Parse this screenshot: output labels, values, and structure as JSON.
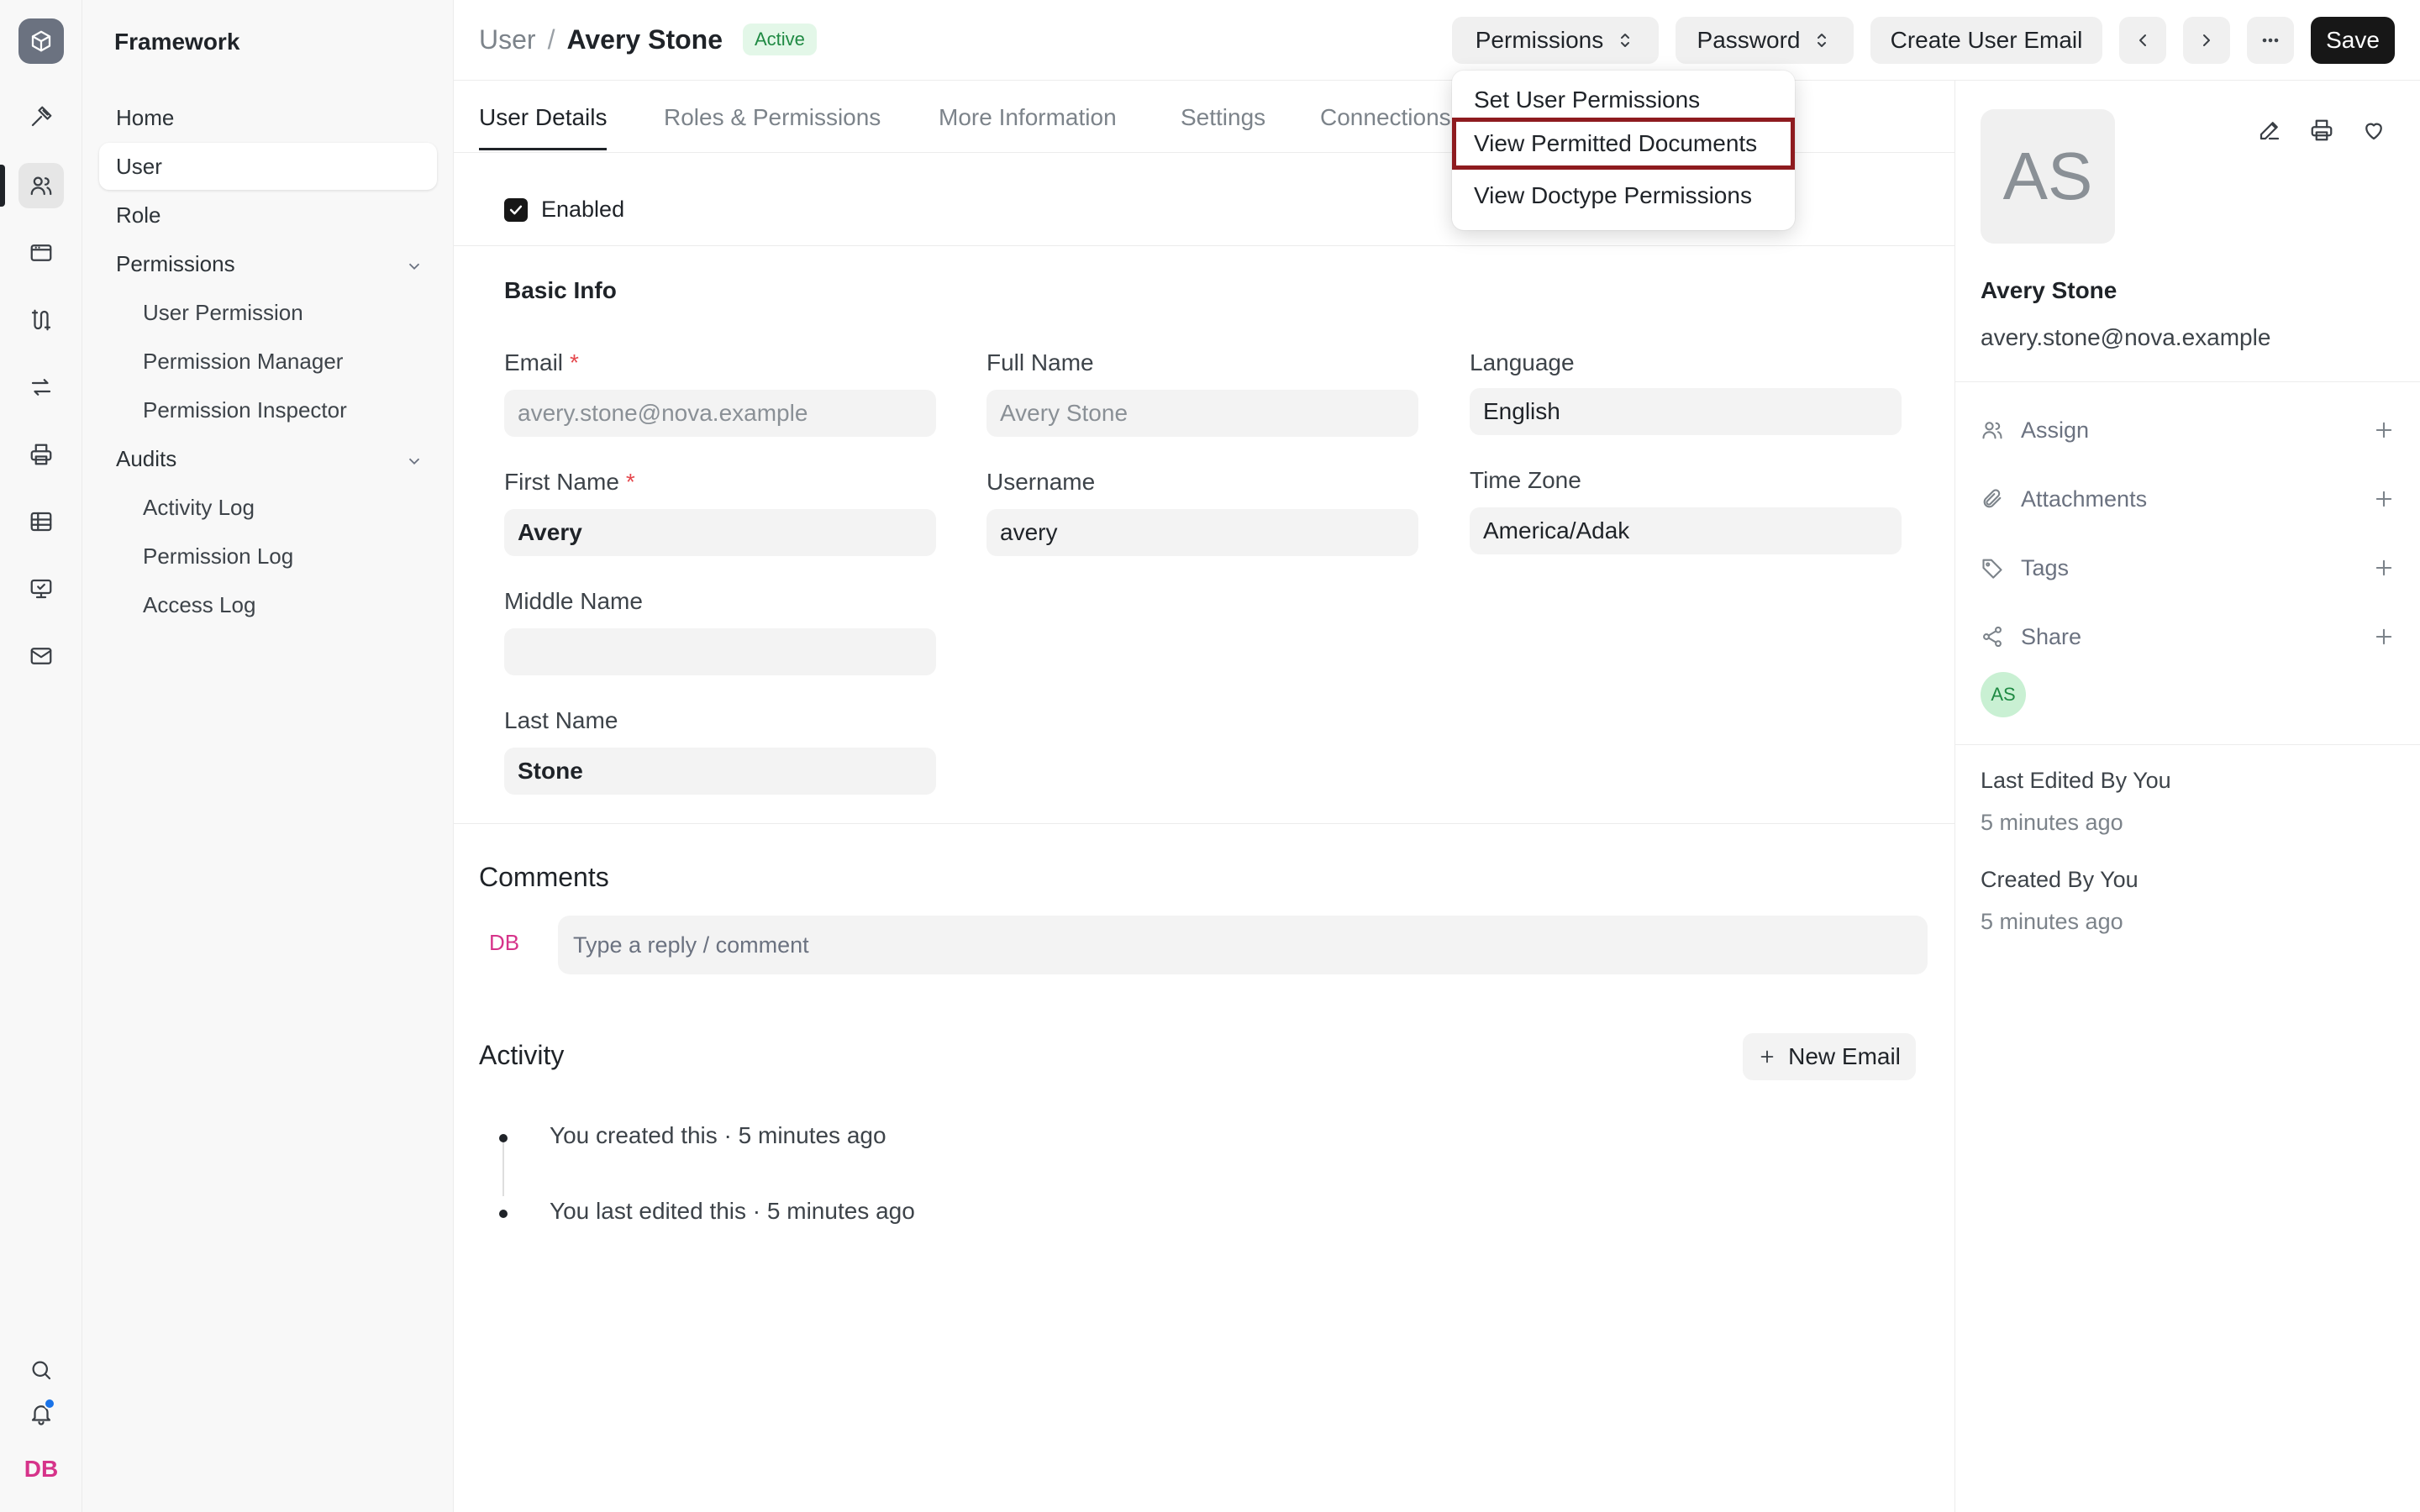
{
  "rail": {
    "user_initials": "DB"
  },
  "sidebar": {
    "app_name": "Framework",
    "items": [
      {
        "label": "Home"
      },
      {
        "label": "User"
      },
      {
        "label": "Role"
      },
      {
        "label": "Permissions"
      },
      {
        "label": "User Permission"
      },
      {
        "label": "Permission Manager"
      },
      {
        "label": "Permission Inspector"
      },
      {
        "label": "Audits"
      },
      {
        "label": "Activity Log"
      },
      {
        "label": "Permission Log"
      },
      {
        "label": "Access Log"
      }
    ]
  },
  "header": {
    "breadcrumb_parent": "User",
    "breadcrumb_sep": "/",
    "title": "Avery Stone",
    "status": "Active",
    "permissions_label": "Permissions",
    "password_label": "Password",
    "create_email_label": "Create User Email",
    "save_label": "Save"
  },
  "dropdown": {
    "items": [
      {
        "label": "Set User Permissions"
      },
      {
        "label": "View Permitted Documents"
      },
      {
        "label": "View Doctype Permissions"
      }
    ]
  },
  "tabs": [
    {
      "label": "User Details"
    },
    {
      "label": "Roles & Permissions"
    },
    {
      "label": "More Information"
    },
    {
      "label": "Settings"
    },
    {
      "label": "Connections"
    }
  ],
  "form": {
    "enabled_label": "Enabled",
    "basic_info_title": "Basic Info",
    "email": {
      "label": "Email",
      "value": "avery.stone@nova.example"
    },
    "full_name": {
      "label": "Full Name",
      "value": "Avery Stone"
    },
    "language": {
      "label": "Language",
      "value": "English"
    },
    "first_name": {
      "label": "First Name",
      "value": "Avery"
    },
    "username": {
      "label": "Username",
      "value": "avery"
    },
    "time_zone": {
      "label": "Time Zone",
      "value": "America/Adak"
    },
    "middle_name": {
      "label": "Middle Name",
      "value": ""
    },
    "last_name": {
      "label": "Last Name",
      "value": "Stone"
    },
    "required_mark": "*"
  },
  "comments": {
    "title": "Comments",
    "avatar_initials": "DB",
    "placeholder": "Type a reply / comment"
  },
  "activity": {
    "title": "Activity",
    "new_email_label": "New Email",
    "entries": [
      {
        "text": "You created this · 5 minutes ago"
      },
      {
        "text": "You last edited this · 5 minutes ago"
      }
    ]
  },
  "right_panel": {
    "avatar_initials": "AS",
    "name": "Avery Stone",
    "email": "avery.stone@nova.example",
    "assign_label": "Assign",
    "attachments_label": "Attachments",
    "tags_label": "Tags",
    "share_label": "Share",
    "share_avatar": "AS",
    "last_edited_label": "Last Edited By You",
    "last_edited_time": "5 minutes ago",
    "created_label": "Created By You",
    "created_time": "5 minutes ago"
  }
}
